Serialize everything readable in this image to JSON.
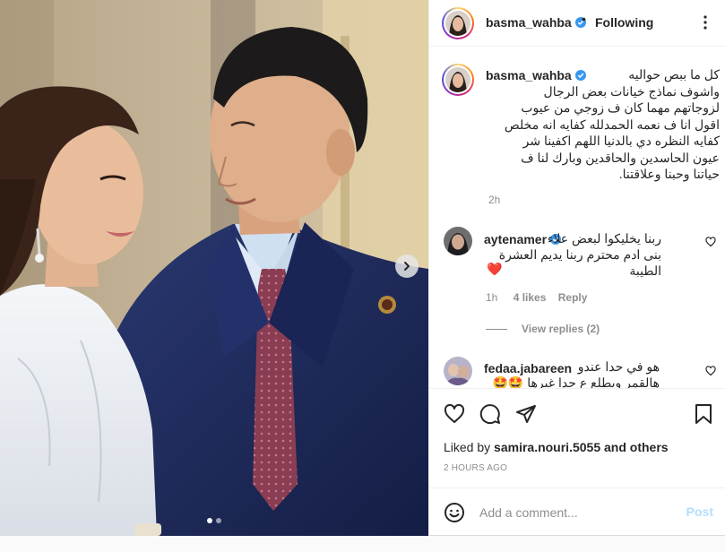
{
  "post": {
    "username": "basma_wahba",
    "verified": true,
    "separator": "•",
    "follow_label": "Following",
    "caption": "كل ما ببص حواليه\nواشوف نماذج خيانات بعض الرجال\nلزوجاتهم مهما كان ف زوجي من عيوب\nاقول انا ف نعمه الحمدلله كفايه انه مخلص\nكفايه النظره دي بالدنيا اللهم اكفينا شر\nعيون الحاسدين والحاقدين وبارك لنا ف\nحياتنا وحبنا وعلاقتنا.",
    "caption_age": "2h",
    "carousel_total": 2,
    "carousel_active": 1
  },
  "comments": [
    {
      "username": "aytenamer",
      "verified": true,
      "text": "ربنا يخليكوا لبعض علاء\nبنى ادم محترم ربنا يديم العشرة الطيبة",
      "emoji": "❤️",
      "age": "1h",
      "likes": "4 likes",
      "reply_label": "Reply",
      "view_replies": "View replies (2)"
    },
    {
      "username": "fedaa.jabareen",
      "verified": false,
      "text": "هو في حدا عندو\nهالقمر ويطلع ع حدا غيرها 🤩🤩🤩🤩"
    }
  ],
  "footer": {
    "liked_by_prefix": "Liked by",
    "liked_by_user": "samira.nouri.5055",
    "liked_by_suffix": "and others",
    "timestamp": "2 HOURS AGO",
    "comment_placeholder": "Add a comment...",
    "post_label": "Post"
  },
  "icons": {
    "like": "heart-icon",
    "comment": "comment-icon",
    "share": "send-icon",
    "save": "bookmark-icon",
    "more": "more-icon",
    "emoji": "emoji-icon",
    "next": "chevron-right-icon"
  },
  "colors": {
    "verified_blue": "#3897f0",
    "post_button": "#b2dffc",
    "muted_text": "#8e8e8e",
    "suit": "#1f2b5a",
    "tie": "#8a3d52",
    "dress": "#e9edf2"
  }
}
